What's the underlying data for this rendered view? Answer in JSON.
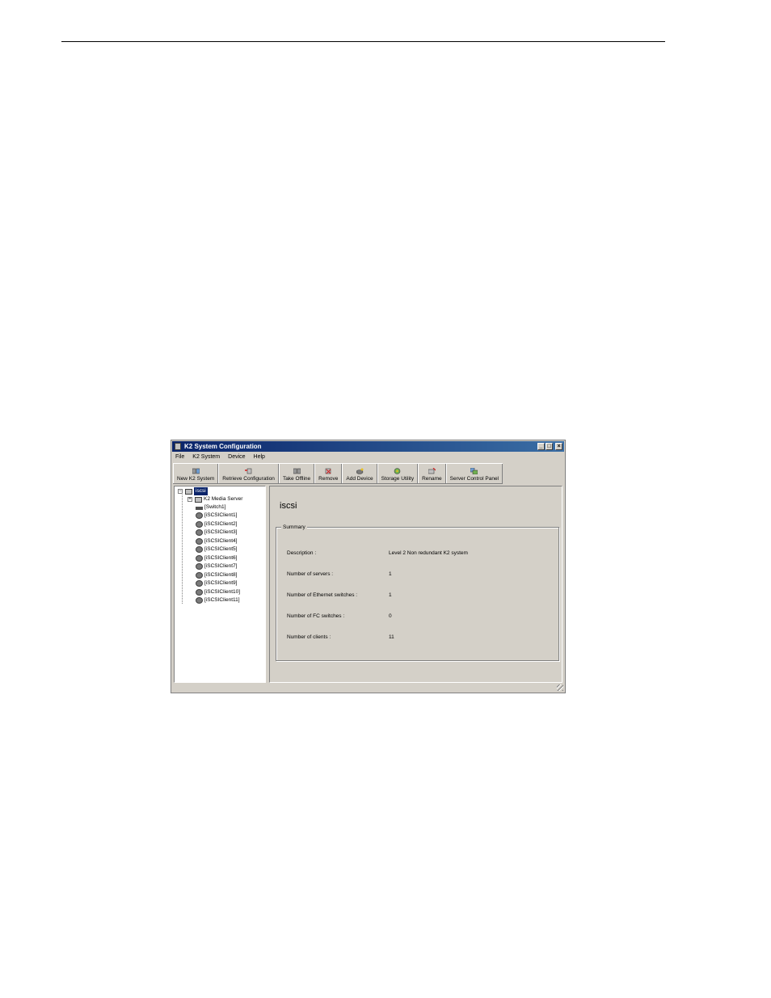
{
  "window": {
    "title": "K2 System Configuration",
    "controls": {
      "minimize": "_",
      "maximize": "□",
      "close": "×"
    }
  },
  "menu": [
    "File",
    "K2 System",
    "Device",
    "Help"
  ],
  "toolbar": [
    {
      "label": "New K2 System",
      "icon": "new-system-icon"
    },
    {
      "label": "Retrieve Configuration",
      "icon": "retrieve-icon"
    },
    {
      "label": "Take Offline",
      "icon": "offline-icon"
    },
    {
      "label": "Remove",
      "icon": "remove-icon"
    },
    {
      "label": "Add Device",
      "icon": "add-device-icon"
    },
    {
      "label": "Storage Utility",
      "icon": "storage-icon"
    },
    {
      "label": "Rename",
      "icon": "rename-icon"
    },
    {
      "label": "Server Control Panel",
      "icon": "control-panel-icon"
    }
  ],
  "tree": {
    "root": {
      "label": "iscsi",
      "expander": "−"
    },
    "server": {
      "label": "K2 Media Server",
      "expander": "+"
    },
    "switch": {
      "label": "[Switch1]"
    },
    "clients": [
      "[iSCSIClient1]",
      "[iSCSIClient2]",
      "[iSCSIClient3]",
      "[iSCSIClient4]",
      "[iSCSIClient5]",
      "[iSCSIClient6]",
      "[iSCSIClient7]",
      "[iSCSIClient8]",
      "[iSCSIClient9]",
      "[iSCSIClient10]",
      "[iSCSIClient11]"
    ]
  },
  "detail": {
    "title": "iscsi",
    "group_label": "Summary",
    "rows": [
      {
        "label": "Description :",
        "value": "Level 2 Non redundant K2 system"
      },
      {
        "label": "Number of servers :",
        "value": "1"
      },
      {
        "label": "Number of Ethernet switches :",
        "value": "1"
      },
      {
        "label": "Number of FC switches :",
        "value": "0"
      },
      {
        "label": "Number of clients :",
        "value": "11"
      }
    ]
  }
}
